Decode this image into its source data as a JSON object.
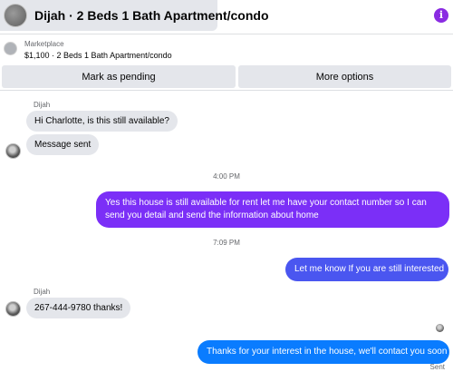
{
  "header": {
    "title": "Dijah · 2 Beds 1 Bath Apartment/condo",
    "info_icon": "info-icon",
    "accent": "#8a2be2"
  },
  "marketplace": {
    "label": "Marketplace",
    "listing": "$1,100 · 2 Beds 1 Bath Apartment/condo",
    "buttons": {
      "mark_pending": "Mark as pending",
      "more_options": "More options"
    }
  },
  "conversation": {
    "sender_name_1": "Dijah",
    "msg_1": "Hi Charlotte, is this still available?",
    "msg_2": "Message sent",
    "time_1": "4:00 PM",
    "msg_3": "Yes this house is still available for rent let me have your contact number so I can send you detail and send the information about home",
    "time_2": "7:09 PM",
    "msg_4": "Let me know If you are still interested",
    "sender_name_2": "Dijah",
    "msg_5": "267-444-9780 thanks!",
    "msg_6": "Thanks for your interest in the house, we'll contact you soon",
    "status": "Sent"
  },
  "colors": {
    "incoming_bubble": "#e4e6eb",
    "outgoing_purple": "#7b2ff7",
    "outgoing_blue": "#0a7cff"
  }
}
